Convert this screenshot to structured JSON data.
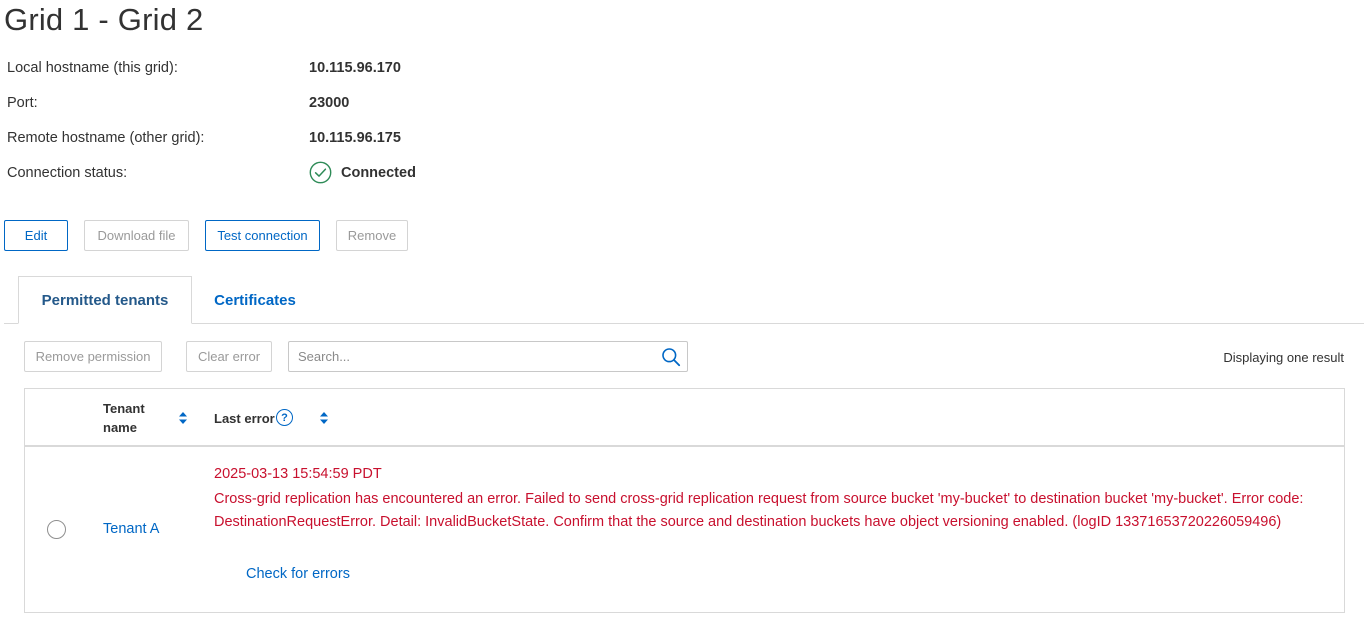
{
  "page": {
    "title": "Grid 1 - Grid 2"
  },
  "details": {
    "local_hostname_label": "Local hostname (this grid):",
    "local_hostname_value": "10.115.96.170",
    "port_label": "Port:",
    "port_value": "23000",
    "remote_hostname_label": "Remote hostname (other grid):",
    "remote_hostname_value": "10.115.96.175",
    "connection_status_label": "Connection status:",
    "connection_status_value": "Connected",
    "connection_status_icon": "check-circle-icon"
  },
  "actions": {
    "edit": "Edit",
    "download_file": "Download file",
    "test_connection": "Test connection",
    "remove": "Remove"
  },
  "tabs": [
    {
      "label": "Permitted tenants",
      "active": true
    },
    {
      "label": "Certificates",
      "active": false
    }
  ],
  "toolbar": {
    "remove_permission": "Remove permission",
    "clear_error": "Clear error",
    "search_placeholder": "Search...",
    "result_count": "Displaying one result"
  },
  "table": {
    "columns": [
      {
        "label": "Tenant name",
        "sortable": true
      },
      {
        "label": "Last error",
        "sortable": true,
        "help": "?"
      }
    ],
    "rows": [
      {
        "tenant_name": "Tenant A",
        "error_time": "2025-03-13 15:54:59 PDT",
        "error_message": "Cross-grid replication has encountered an error. Failed to send cross-grid replication request from source bucket 'my-bucket' to destination bucket 'my-bucket'. Error code: DestinationRequestError. Detail: InvalidBucketState. Confirm that the source and destination buckets have object versioning enabled. (logID 13371653720226059496)",
        "check_link": "Check for errors"
      }
    ]
  },
  "colors": {
    "primary": "#0067c5",
    "error": "#c8102e",
    "success": "#2e8b57",
    "disabled": "#9a9a9a"
  }
}
